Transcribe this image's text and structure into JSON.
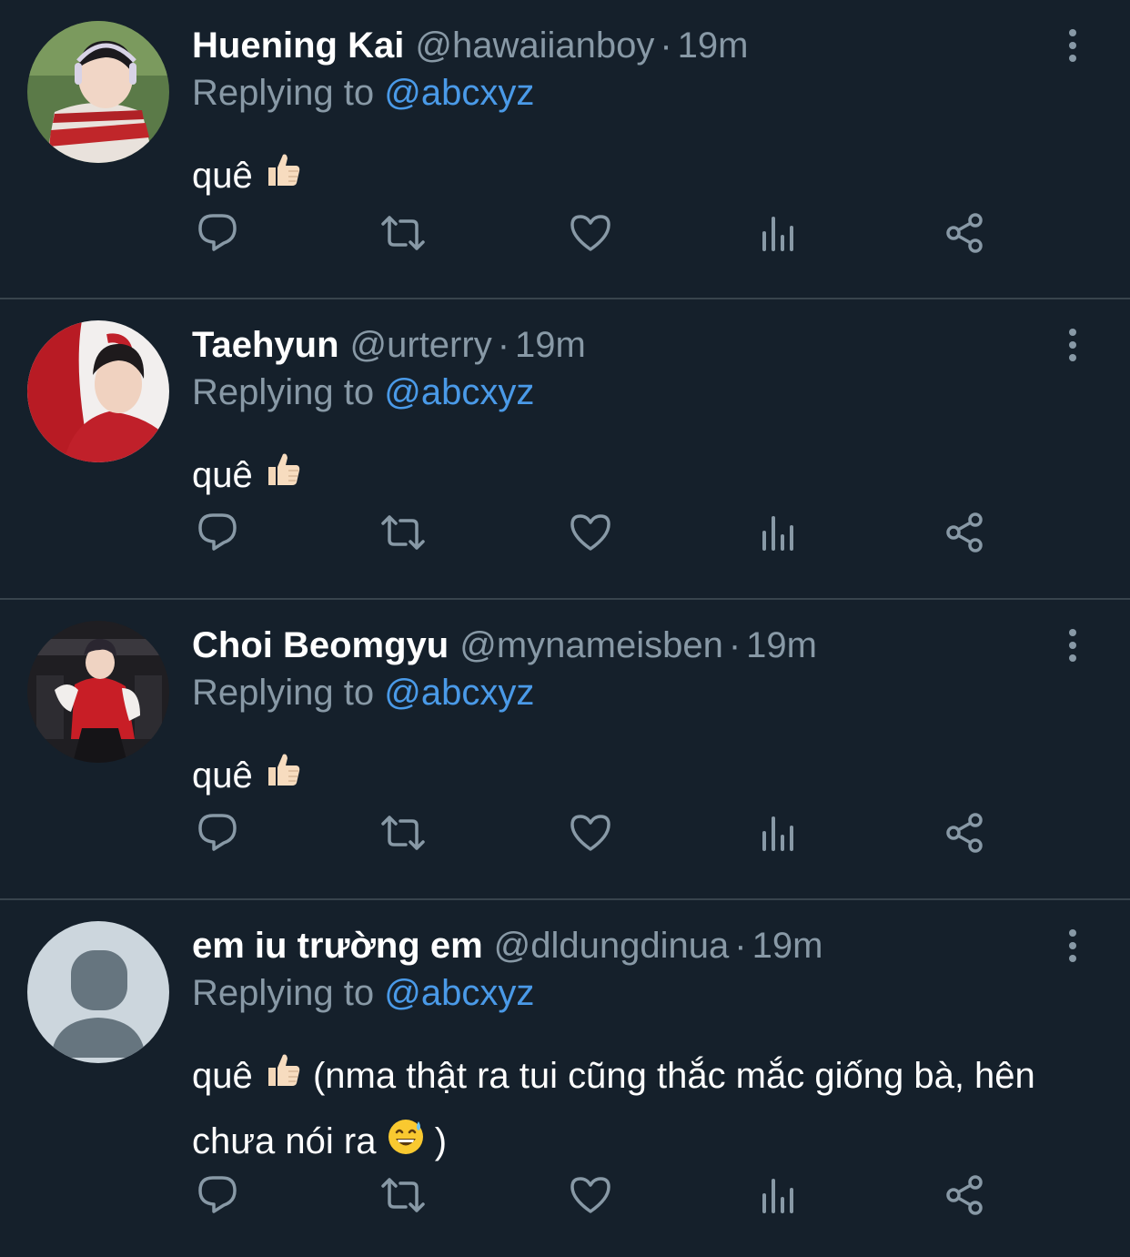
{
  "colors": {
    "background": "#15202b",
    "divider": "#38444d",
    "muted": "#8899a6",
    "mention": "#4a9ae8",
    "text": "#ffffff"
  },
  "tweets": [
    {
      "name": "Huening Kai",
      "handle": "@hawaiianboy",
      "separator": "·",
      "time": "19m",
      "replying_prefix": "Replying to",
      "replying_to": "@abcxyz",
      "text_main": "quê",
      "text_extra": "",
      "icons": [
        "thumbs-up-emoji",
        "reply-icon",
        "retweet-icon",
        "like-icon",
        "stats-icon",
        "share-icon",
        "more-icon"
      ]
    },
    {
      "name": "Taehyun",
      "handle": "@urterry",
      "separator": "·",
      "time": "19m",
      "replying_prefix": "Replying to",
      "replying_to": "@abcxyz",
      "text_main": "quê",
      "text_extra": ""
    },
    {
      "name": "Choi Beomgyu",
      "handle": "@mynameisben",
      "separator": "·",
      "time": "19m",
      "replying_prefix": "Replying to",
      "replying_to": "@abcxyz",
      "text_main": "quê",
      "text_extra": ""
    },
    {
      "name": "em iu trường em",
      "handle": "@dldungdinua",
      "separator": "·",
      "time": "19m",
      "replying_prefix": "Replying to",
      "replying_to": "@abcxyz",
      "text_main": "quê",
      "text_extra": " (nma thật ra tui cũng thắc mắc giống bà, hên chưa nói ra",
      "text_tail": ")"
    }
  ]
}
